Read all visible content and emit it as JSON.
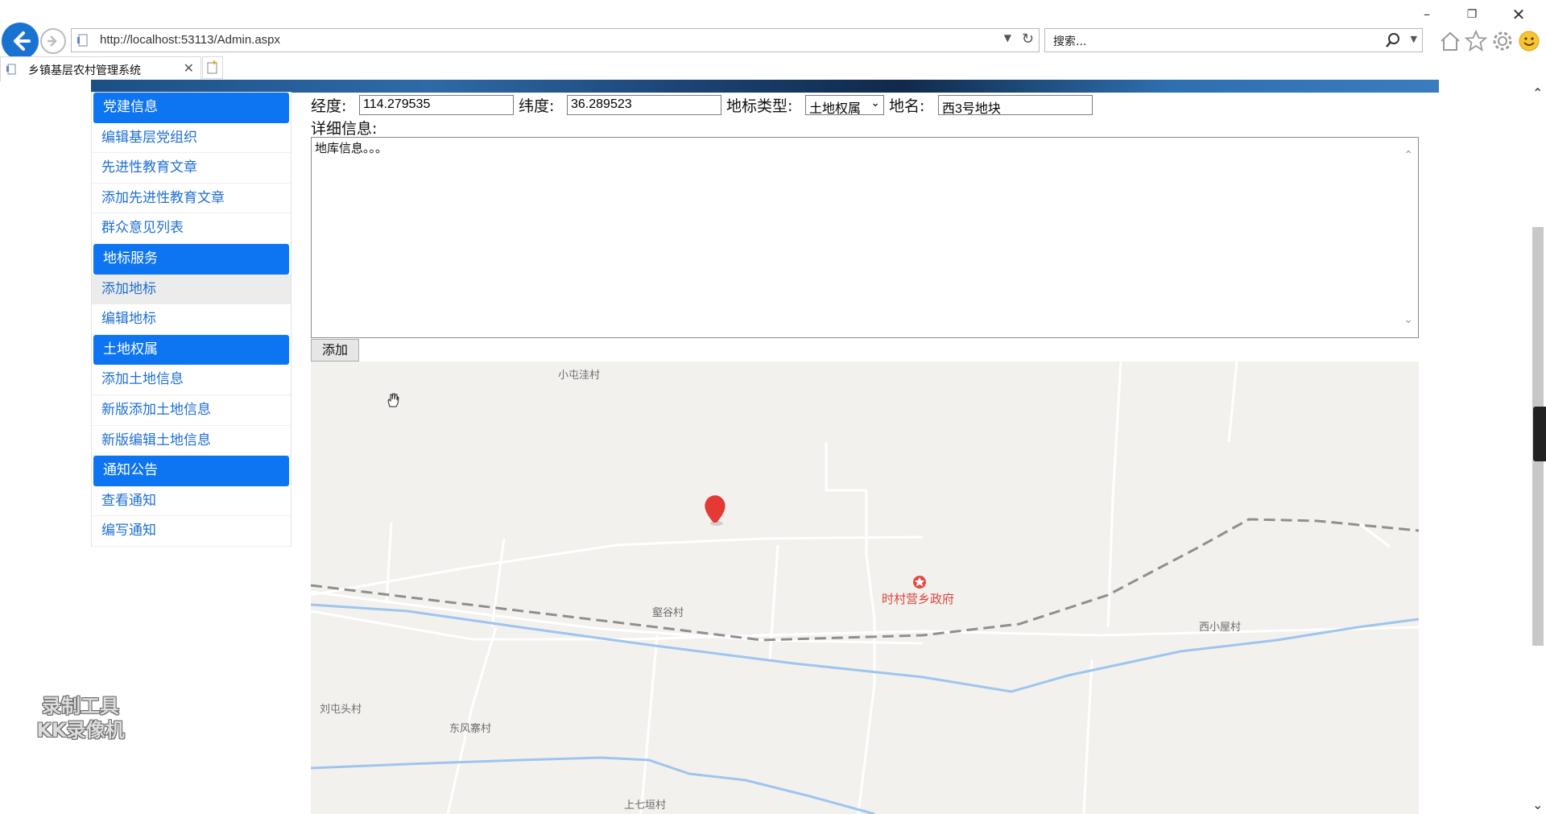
{
  "browser": {
    "url": "http://localhost:53113/Admin.aspx",
    "search_placeholder": "搜索...",
    "tab_title": "乡镇基层农村管理系统",
    "window_controls": [
      "minimize-icon",
      "restore-icon",
      "close-icon"
    ]
  },
  "sidebar": {
    "items": [
      {
        "label": "党建信息",
        "type": "header"
      },
      {
        "label": "编辑基层党组织",
        "type": "link"
      },
      {
        "label": "先进性教育文章",
        "type": "link"
      },
      {
        "label": "添加先进性教育文章",
        "type": "link"
      },
      {
        "label": "群众意见列表",
        "type": "link"
      },
      {
        "label": "地标服务",
        "type": "header"
      },
      {
        "label": "添加地标",
        "type": "link",
        "active": true
      },
      {
        "label": "编辑地标",
        "type": "link"
      },
      {
        "label": "土地权属",
        "type": "header"
      },
      {
        "label": "添加土地信息",
        "type": "link"
      },
      {
        "label": "新版添加土地信息",
        "type": "link"
      },
      {
        "label": "新版编辑土地信息",
        "type": "link"
      },
      {
        "label": "通知公告",
        "type": "header"
      },
      {
        "label": "查看通知",
        "type": "link"
      },
      {
        "label": "编写通知",
        "type": "link"
      }
    ]
  },
  "form": {
    "longitude_label": "经度:",
    "longitude_value": "114.279535",
    "latitude_label": "纬度:",
    "latitude_value": "36.289523",
    "type_label": "地标类型:",
    "type_value": "土地权属",
    "name_label": "地名:",
    "name_value": "西3号地块",
    "detail_label": "详细信息:",
    "detail_value": "地库信息。。。",
    "submit_label": "添加"
  },
  "map": {
    "labels": {
      "xiaotunwa": "小屯洼村",
      "jiagu": "壑谷村",
      "shicun_gov": "时村营乡政府",
      "xixiaotun": "西小屋村",
      "liutuntou": "刘屯头村",
      "dongfengzhai": "东风寨村",
      "shangqiyuan": "上七垣村"
    },
    "marker_color": "#e53935"
  },
  "watermark": {
    "line1": "录制工具",
    "line2": "KK录像机"
  },
  "colors": {
    "accent": "#0d75f2",
    "link": "#1f6fd0",
    "back_button": "#1a72d0"
  }
}
